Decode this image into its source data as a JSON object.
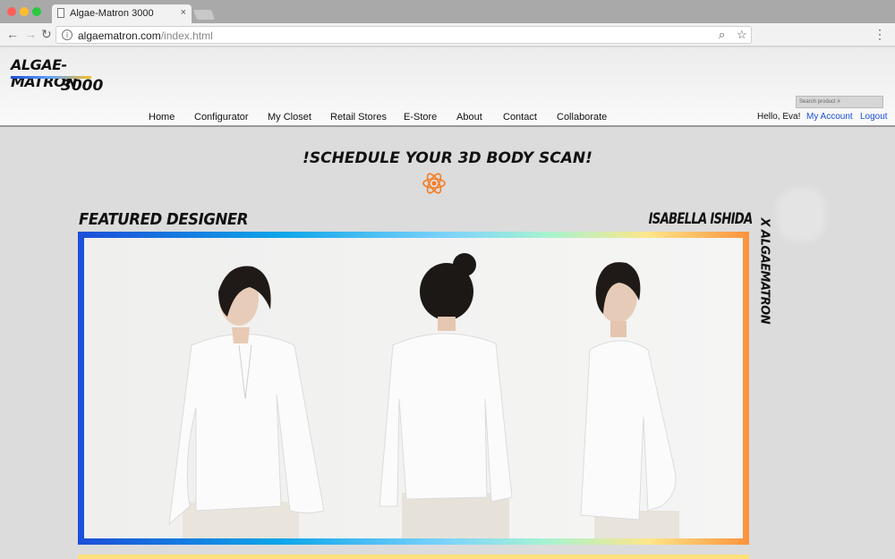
{
  "browser": {
    "tab_title": "Algae-Matron 3000",
    "tab_close": "×",
    "url_host": "algaematron.com",
    "url_path": "/index.html",
    "back_icon": "←",
    "forward_icon": "→",
    "reload_icon": "↻",
    "zoom_icon": "⌕",
    "star_icon": "☆",
    "menu_icon": "⋮",
    "info_icon": "i",
    "traffic_colors": [
      "#fc5f57",
      "#fdbc2e",
      "#29c940"
    ]
  },
  "header": {
    "logo_line1": "ALGAE-MATRON",
    "logo_line2": "3000",
    "search_placeholder": "Search product #",
    "nav": [
      "Home",
      "Configurator",
      "My Closet",
      "Retail Stores",
      "E-Store",
      "About",
      "Contact",
      "Collaborate"
    ],
    "greeting": "Hello, Eva!",
    "my_account": "My Account",
    "logout": "Logout",
    "link_color": "#1a4fd6"
  },
  "main": {
    "headline": "!SCHEDULE YOUR 3D BODY SCAN!",
    "atom_color": "#f47c20",
    "featured_label": "FEATURED DESIGNER",
    "designer_name": "ISABELLA ISHIDA",
    "brand_vertical": "X ALGAEMATRON"
  }
}
